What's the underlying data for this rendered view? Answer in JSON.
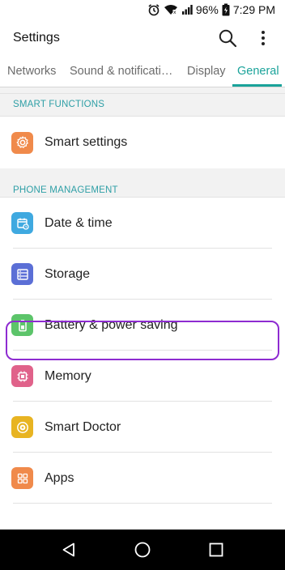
{
  "status": {
    "battery_percent": "96%",
    "time": "7:29 PM"
  },
  "app_bar": {
    "title": "Settings"
  },
  "tabs": [
    {
      "label": "Networks",
      "active": false
    },
    {
      "label": "Sound & notificati…",
      "active": false
    },
    {
      "label": "Display",
      "active": false
    },
    {
      "label": "General",
      "active": true
    }
  ],
  "sections": [
    {
      "header": "SMART FUNCTIONS",
      "items": [
        {
          "label": "Smart settings",
          "icon": "gear-icon",
          "color": "#f08a4b"
        }
      ]
    },
    {
      "header": "PHONE MANAGEMENT",
      "items": [
        {
          "label": "Date & time",
          "icon": "calendar-clock-icon",
          "color": "#3fa9e0"
        },
        {
          "label": "Storage",
          "icon": "storage-icon",
          "color": "#5b6fd6"
        },
        {
          "label": "Battery & power saving",
          "icon": "battery-icon",
          "color": "#5cc46a",
          "highlighted": true
        },
        {
          "label": "Memory",
          "icon": "chip-icon",
          "color": "#e0628a"
        },
        {
          "label": "Smart Doctor",
          "icon": "smart-doctor-icon",
          "color": "#e8b422"
        },
        {
          "label": "Apps",
          "icon": "apps-grid-icon",
          "color": "#f08a4b"
        }
      ]
    }
  ],
  "colors": {
    "accent": "#1aa39a",
    "section_header": "#2e9fa6",
    "highlight_border": "#8e2bd1"
  }
}
